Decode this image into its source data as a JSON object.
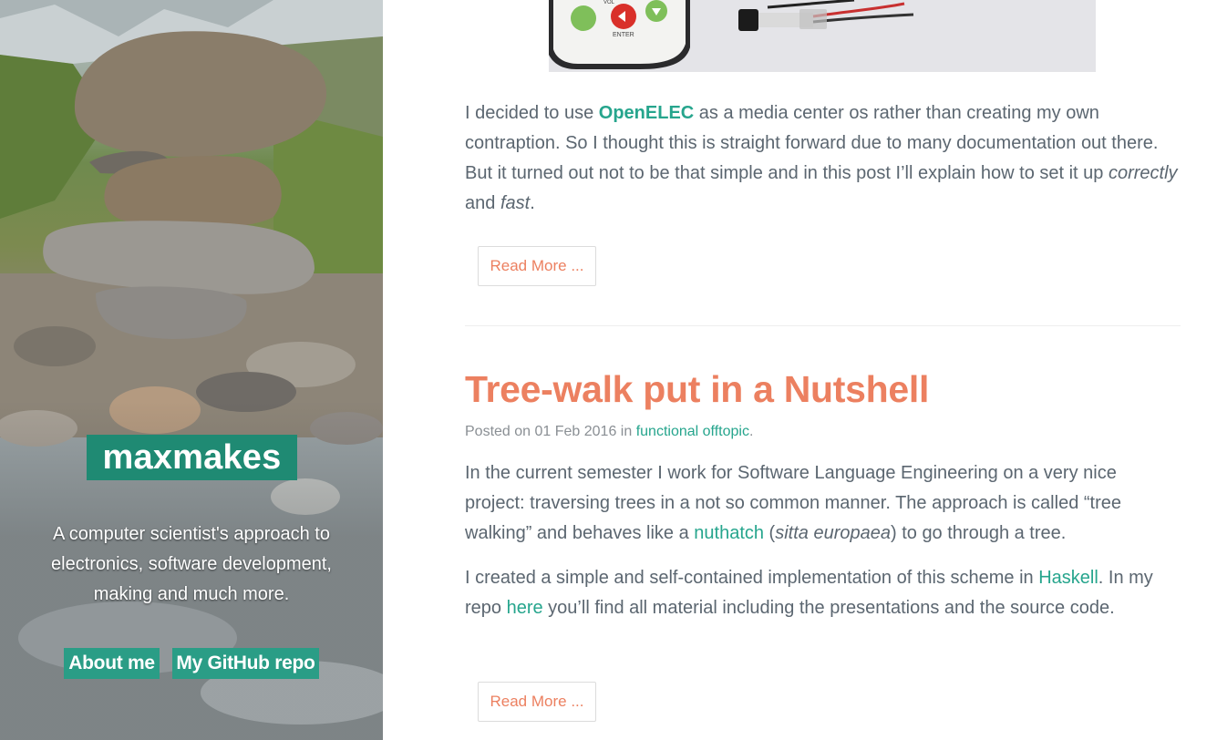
{
  "sidebar": {
    "brand": "maxmakes",
    "tagline": "A computer scientist's approach to electronics, software development, making and much more.",
    "nav": [
      {
        "label": "About me"
      },
      {
        "label": "My GitHub repo"
      }
    ]
  },
  "posts": [
    {
      "image": {
        "remote_button_label": "ENTER",
        "remote_top_label": "VOL"
      },
      "excerpt": {
        "p1": "I decided to use ",
        "link": "OpenELEC",
        "p2": " as a media center os rather than creating my own contraption. So I thought this is straight forward due to many documentation out there. But it turned out not to be that simple and in this post I’ll explain how to set it up ",
        "em1": "correctly",
        "p3": " and ",
        "em2": "fast",
        "p4": "."
      },
      "read_more": "Read More ..."
    },
    {
      "title": "Tree-walk put in a Nutshell",
      "meta": {
        "prefix": "Posted on 01 Feb 2016 in ",
        "category": "functional offtopic",
        "suffix": "."
      },
      "para1": {
        "p1": "In the current semester I work for Software Language Engineering on a very nice project: traversing trees in a not so common manner. The approach is called “tree walking” and behaves like a ",
        "link": "nuthatch",
        "p2": " (",
        "em": "sitta europaea",
        "p3": ") to go through a tree."
      },
      "para2": {
        "p1": "I created a simple and self-contained implementation of this scheme in ",
        "link1": "Haskell",
        "p2": ". In my repo ",
        "link2": "here",
        "p3": " you’ll find all material including the presentations and the source code."
      },
      "read_more": "Read More ..."
    }
  ],
  "colors": {
    "accent": "#26a58d",
    "brand_bg": "#1f8a73",
    "title": "#ec8060",
    "text": "#5b6670"
  }
}
